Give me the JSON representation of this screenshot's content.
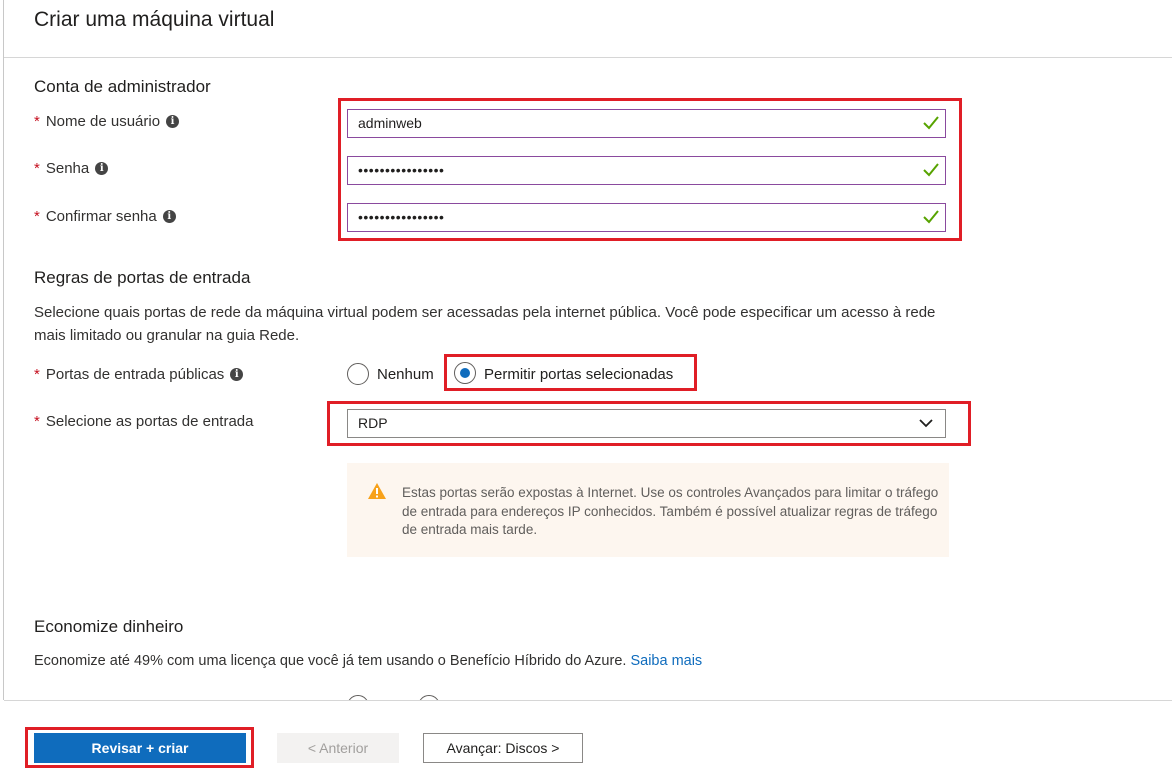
{
  "header": {
    "title": "Criar uma máquina virtual"
  },
  "admin": {
    "section_title": "Conta de administrador",
    "username_label": "Nome de usuário",
    "username_value": "adminweb",
    "password_label": "Senha",
    "password_value": "••••••••••••••••",
    "confirm_label": "Confirmar senha",
    "confirm_value": "••••••••••••••••"
  },
  "ports": {
    "section_title": "Regras de portas de entrada",
    "description": "Selecione quais portas de rede da máquina virtual podem ser acessadas pela internet pública. Você pode especificar um acesso à rede mais limitado ou granular na guia Rede.",
    "public_ports_label": "Portas de entrada públicas",
    "option_none": "Nenhum",
    "option_allow": "Permitir portas selecionadas",
    "selected_option": "Permitir portas selecionadas",
    "select_label": "Selecione as portas de entrada",
    "select_value": "RDP",
    "warning": "Estas portas serão expostas à Internet. Use os controles Avançados para limitar o tráfego de entrada para endereços IP conhecidos. Também é possível atualizar regras de tráfego de entrada mais tarde."
  },
  "savings": {
    "section_title": "Economize dinheiro",
    "text": "Economize até 49% com uma licença que você já tem usando o Benefício Híbrido do Azure.",
    "link": "Saiba mais"
  },
  "footer": {
    "review_create": "Revisar + criar",
    "previous": "< Anterior",
    "next": "Avançar: Discos >"
  },
  "colors": {
    "accent": "#0f6cbd",
    "highlight": "#e01e26",
    "valid": "#57a300",
    "warning": "#f7a11a"
  },
  "icons": [
    "info-icon",
    "checkmark-icon",
    "chevron-down-icon",
    "warning-icon"
  ]
}
